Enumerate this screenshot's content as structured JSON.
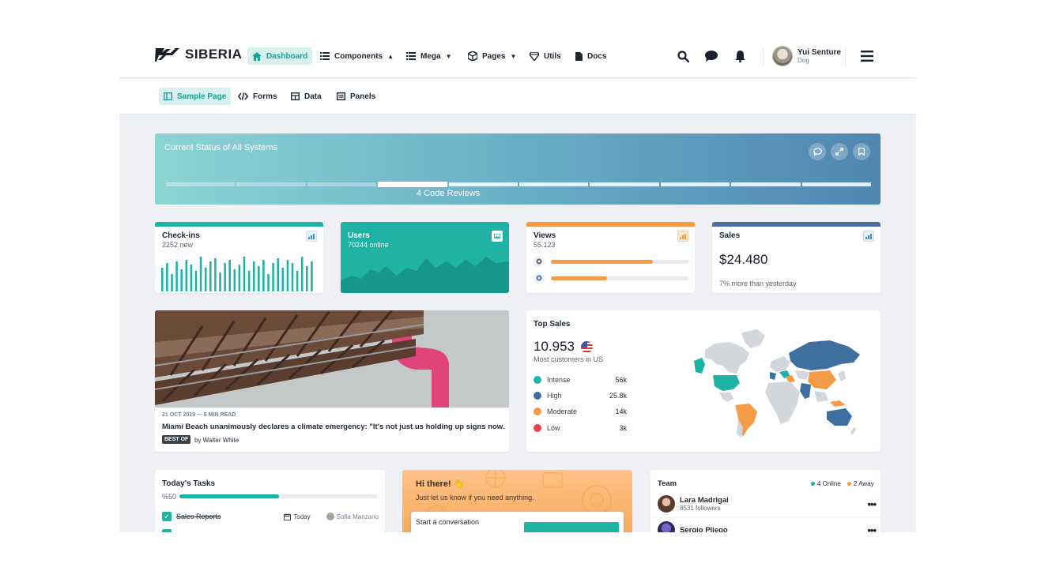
{
  "brand": {
    "name": "SIBERIA"
  },
  "topnav": {
    "items": [
      {
        "label": "Dashboard",
        "icon": "home-icon",
        "active": true
      },
      {
        "label": "Components",
        "icon": "list-icon",
        "caret": "up"
      },
      {
        "label": "Mega",
        "icon": "list-icon",
        "caret": "down"
      },
      {
        "label": "Pages",
        "icon": "box-icon",
        "caret": "down"
      },
      {
        "label": "Utils",
        "icon": "gem-icon"
      },
      {
        "label": "Docs",
        "icon": "file-icon"
      }
    ],
    "user": {
      "name": "Yui Senture",
      "role": "Dog"
    }
  },
  "subnav": {
    "items": [
      {
        "label": "Sample Page",
        "active": true
      },
      {
        "label": "Forms"
      },
      {
        "label": "Data"
      },
      {
        "label": "Panels"
      }
    ]
  },
  "banner": {
    "title": "Current Status of All Systems",
    "caption": "4 Code Reviews",
    "segments_total": 10,
    "active_segment": 4
  },
  "cards": {
    "checkins": {
      "title": "Check-ins",
      "sub": "2252 new",
      "accent": "#1fb3a6"
    },
    "users": {
      "title": "Users",
      "sub": "70244 online",
      "accent": "#1fb3a6"
    },
    "views": {
      "title": "Views",
      "sub": "55.123",
      "accent": "#f39c45",
      "bars": [
        0.74,
        0.41
      ]
    },
    "sales": {
      "title": "Sales",
      "value": "$24.480",
      "sub": "7% more than yesterday",
      "accent": "#4f6fa3"
    }
  },
  "news": {
    "meta": "21 OCT 2019 — 6 MIN READ",
    "headline": "Miami Beach unanimously declares a climate emergency: \"It's not just us holding up signs now.",
    "tag": "BEST OF",
    "byline": "by Walter White"
  },
  "top_sales": {
    "title": "Top Sales",
    "value": "10.953",
    "sub": "Most customers in US",
    "legend": [
      {
        "label": "Intense",
        "value": "56k",
        "color": "#1fb3a6"
      },
      {
        "label": "High",
        "value": "25.8k",
        "color": "#3f6f9f"
      },
      {
        "label": "Moderate",
        "value": "14k",
        "color": "#f39c45"
      },
      {
        "label": "Low",
        "value": "3k",
        "color": "#e8424a"
      }
    ]
  },
  "tasks": {
    "title": "Today's Tasks",
    "pct_label": "%50",
    "progress": 0.5,
    "row": {
      "label": "Sales Reports",
      "due": "Today",
      "assignee": "Sofia Manzano"
    }
  },
  "hi": {
    "title": "Hi there! 👋",
    "sub": "Just let us know if you need anything.",
    "conv": "Start a conversation"
  },
  "team": {
    "title": "Team",
    "online": "4 Online",
    "away": "2 Away",
    "members": [
      {
        "name": "Lara Madrigal",
        "followers": "8531 followers"
      },
      {
        "name": "Sergio Pliego",
        "followers": ""
      }
    ]
  }
}
